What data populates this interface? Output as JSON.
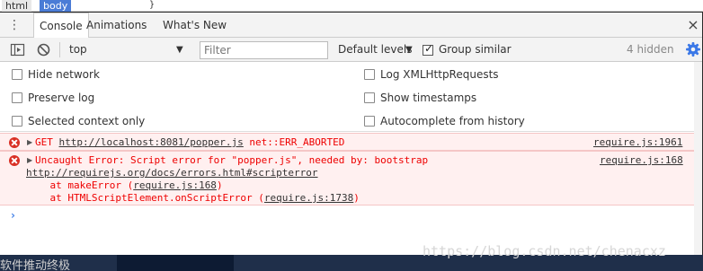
{
  "background": {
    "crumbs": [
      "html",
      "body"
    ],
    "brace": "}",
    "bottom_text": "软件推动终极"
  },
  "tabs": {
    "items": [
      {
        "label": "Console",
        "active": true
      },
      {
        "label": "Animations",
        "active": false
      },
      {
        "label": "What's New",
        "active": false
      }
    ],
    "close": "×"
  },
  "toolbar": {
    "context": "top",
    "filter_placeholder": "Filter",
    "levels": "Default levels",
    "group_similar": "Group similar",
    "group_similar_checked": true,
    "hidden_count": "4 hidden"
  },
  "settings": {
    "hide_network": "Hide network",
    "preserve_log": "Preserve log",
    "selected_context": "Selected context only",
    "log_xhr": "Log XMLHttpRequests",
    "show_timestamps": "Show timestamps",
    "autocomplete": "Autocomplete from history"
  },
  "messages": [
    {
      "prefix": "GET ",
      "url": "http://localhost:8081/popper.js",
      "suffix": " net::ERR_ABORTED",
      "source": "require.js:1961"
    },
    {
      "line1": "Uncaught Error: Script error for \"popper.js\", needed by: bootstrap",
      "url": "http://requirejs.org/docs/errors.html#scripterror",
      "stack1_pre": "    at makeError (",
      "stack1_link": "require.js:168",
      "stack1_post": ")",
      "stack2_pre": "    at HTMLScriptElement.onScriptError (",
      "stack2_link": "require.js:1738",
      "stack2_post": ")",
      "source": "require.js:168"
    }
  ],
  "prompt": "›",
  "watermark": "https://blog.csdn.net/chenacxz",
  "colors": {
    "error_bg": "#fff0f0",
    "error_text": "#ee0000",
    "accent": "#4a86e8"
  }
}
